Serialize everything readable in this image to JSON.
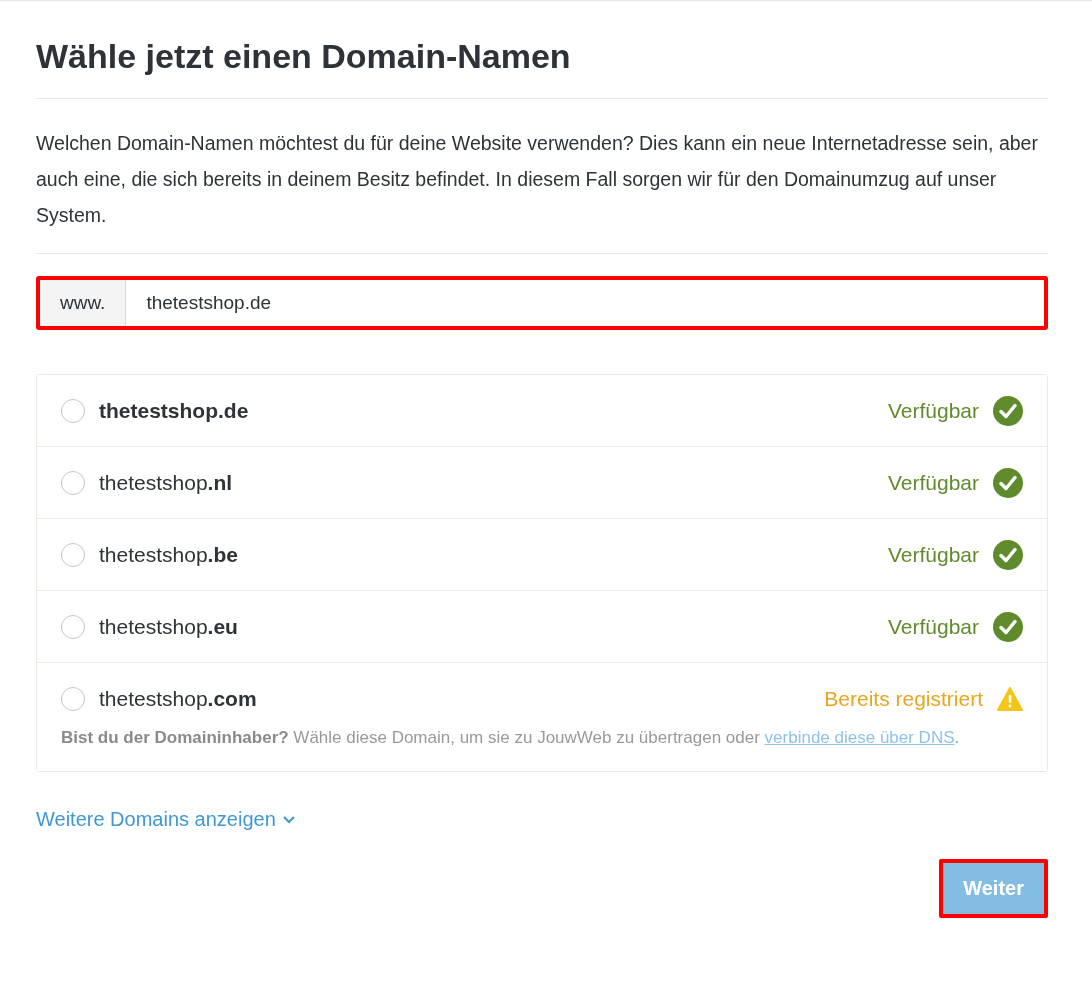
{
  "title": "Wähle jetzt einen Domain-Namen",
  "intro": "Welchen Domain-Namen möchtest du für deine Website verwenden? Dies kann ein neue Internetadresse sein, aber auch eine, die sich bereits in deinem Besitz befindet. In diesem Fall sorgen wir für den Domainumzug auf unser System.",
  "domain_field": {
    "prefix": "www.",
    "value": "thetestshop.de",
    "highlighted": true
  },
  "domains": [
    {
      "name": "thetestshop",
      "tld": ".de",
      "exact_match": true,
      "selected": false,
      "kind": "available",
      "status": "Verfügbar"
    },
    {
      "name": "thetestshop",
      "tld": ".nl",
      "exact_match": false,
      "selected": false,
      "kind": "available",
      "status": "Verfügbar"
    },
    {
      "name": "thetestshop",
      "tld": ".be",
      "exact_match": false,
      "selected": false,
      "kind": "available",
      "status": "Verfügbar"
    },
    {
      "name": "thetestshop",
      "tld": ".eu",
      "exact_match": false,
      "selected": false,
      "kind": "available",
      "status": "Verfügbar"
    },
    {
      "name": "thetestshop",
      "tld": ".com",
      "exact_match": false,
      "selected": false,
      "kind": "registered",
      "status": "Bereits registriert",
      "note": "**Bist du der Domaininhaber?** Wähle diese Domain, um sie zu JouwWeb zu übertragen oder ",
      "note_link": "verbinde diese über DNS",
      "note_end": "."
    }
  ],
  "more_link": "Weitere Domains anzeigen",
  "next_button": {
    "label": "Weiter",
    "disabled": true,
    "highlighted": true
  }
}
